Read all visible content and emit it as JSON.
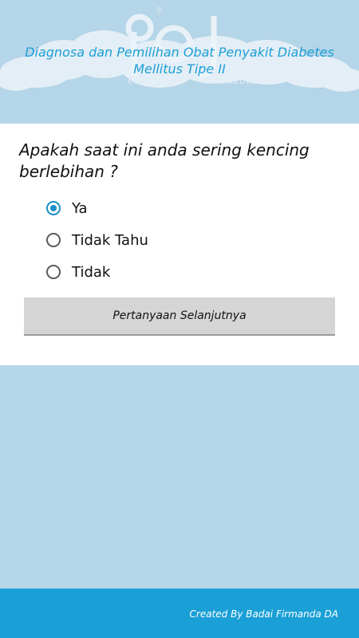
{
  "header": {
    "title": "Diagnosa dan Pemilihan Obat Penyakit Diabetes Mellitus Tipe II",
    "logo_words": [
      "bat",
      "emilihan",
      "iabetes"
    ]
  },
  "question": {
    "text": "Apakah saat ini anda sering kencing berlebihan ?"
  },
  "options": [
    {
      "label": "Ya",
      "selected": true
    },
    {
      "label": "Tidak Tahu",
      "selected": false
    },
    {
      "label": "Tidak",
      "selected": false
    }
  ],
  "next_button": {
    "label": "Pertanyaan Selanjutnya"
  },
  "footer": {
    "credit": "Created By Badai Firmanda DA"
  },
  "colors": {
    "background": "#b5d5e8",
    "accent": "#1a9fd6",
    "title_text": "#1d9fd6"
  }
}
